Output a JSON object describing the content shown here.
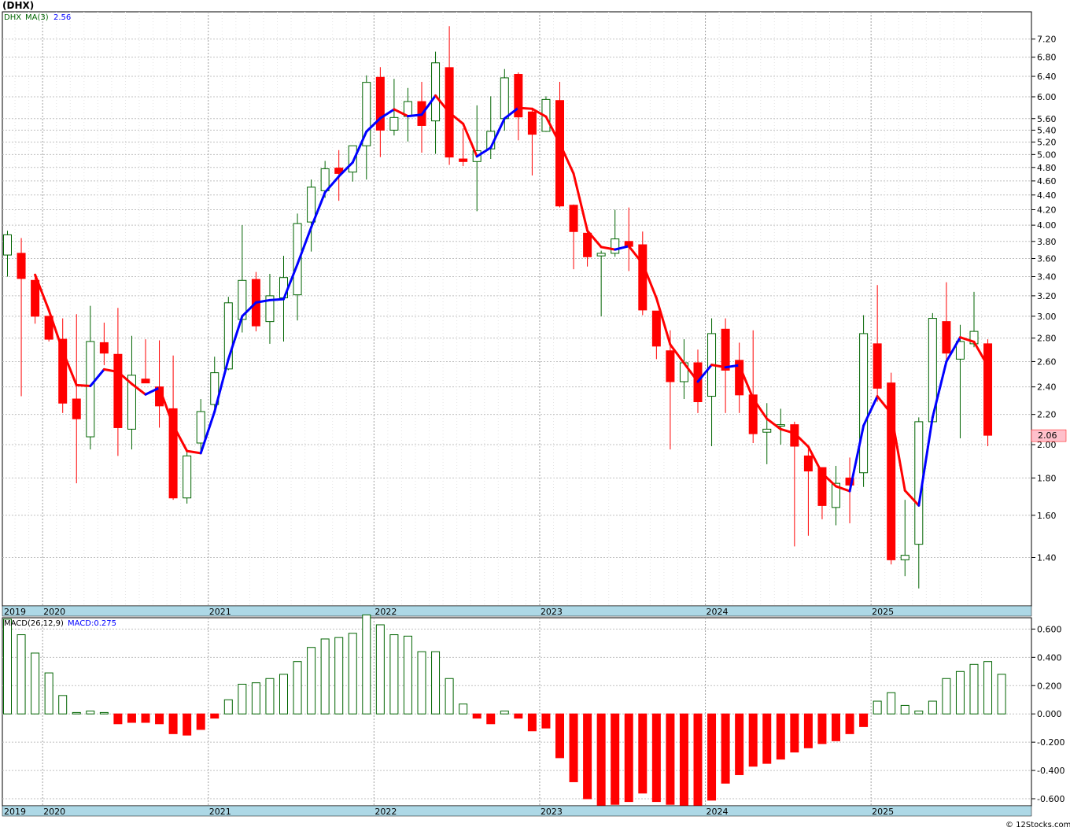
{
  "title": "(DHX)",
  "price_legend": {
    "symbol": "DHX",
    "ma_label": "MA(3)",
    "ma_value": "2.56"
  },
  "macd_legend": {
    "label": "MACD(26,12,9)",
    "value_label": "MACD:0.275"
  },
  "last_price_label": "2.06",
  "copyright": "© 12Stocks.com",
  "colors": {
    "up": "#006400",
    "down": "#ff0000",
    "ma_up": "#0000ff",
    "ma_down": "#ff0000",
    "axis_band": "#add8e6",
    "grid": "#c0c0c0",
    "price_tag_bg": "#ffc0cb"
  },
  "chart_data": [
    {
      "type": "candlestick",
      "scale": "log",
      "grid": true,
      "x_labels": [
        "2019",
        "2020",
        "2021",
        "2022",
        "2023",
        "2024",
        "2025"
      ],
      "y_ticks": [
        "1.40",
        "1.60",
        "1.80",
        "2.00",
        "2.20",
        "2.40",
        "2.60",
        "2.80",
        "3.00",
        "3.20",
        "3.40",
        "3.60",
        "3.80",
        "4.00",
        "4.20",
        "4.40",
        "4.60",
        "4.80",
        "5.00",
        "5.20",
        "5.40",
        "5.60",
        "6.00",
        "6.40",
        "6.80",
        "7.20"
      ],
      "candles": [
        {
          "o": 3.64,
          "h": 3.93,
          "l": 3.4,
          "c": 3.88
        },
        {
          "o": 3.66,
          "h": 3.84,
          "l": 2.33,
          "c": 3.38
        },
        {
          "o": 3.36,
          "h": 3.43,
          "l": 2.93,
          "c": 3.0
        },
        {
          "o": 3.0,
          "h": 3.0,
          "l": 2.77,
          "c": 2.79
        },
        {
          "o": 2.79,
          "h": 2.98,
          "l": 2.21,
          "c": 2.28
        },
        {
          "o": 2.31,
          "h": 3.02,
          "l": 1.77,
          "c": 2.17
        },
        {
          "o": 2.05,
          "h": 3.1,
          "l": 1.97,
          "c": 2.77
        },
        {
          "o": 2.76,
          "h": 2.94,
          "l": 2.57,
          "c": 2.67
        },
        {
          "o": 2.66,
          "h": 3.08,
          "l": 1.93,
          "c": 2.11
        },
        {
          "o": 2.1,
          "h": 2.82,
          "l": 1.97,
          "c": 2.49
        },
        {
          "o": 2.46,
          "h": 2.79,
          "l": 2.43,
          "c": 2.43
        },
        {
          "o": 2.4,
          "h": 2.78,
          "l": 2.11,
          "c": 2.26
        },
        {
          "o": 2.24,
          "h": 2.65,
          "l": 1.68,
          "c": 1.69
        },
        {
          "o": 1.69,
          "h": 1.97,
          "l": 1.66,
          "c": 1.93
        },
        {
          "o": 2.01,
          "h": 2.31,
          "l": 1.94,
          "c": 2.22
        },
        {
          "o": 2.27,
          "h": 2.64,
          "l": 2.2,
          "c": 2.51
        },
        {
          "o": 2.54,
          "h": 3.19,
          "l": 2.53,
          "c": 3.13
        },
        {
          "o": 2.97,
          "h": 4.0,
          "l": 2.85,
          "c": 3.36
        },
        {
          "o": 3.37,
          "h": 3.45,
          "l": 2.86,
          "c": 2.91
        },
        {
          "o": 2.95,
          "h": 3.43,
          "l": 2.75,
          "c": 3.2
        },
        {
          "o": 3.18,
          "h": 3.63,
          "l": 2.77,
          "c": 3.39
        },
        {
          "o": 3.21,
          "h": 4.15,
          "l": 2.96,
          "c": 4.02
        },
        {
          "o": 4.04,
          "h": 4.62,
          "l": 3.68,
          "c": 4.51
        },
        {
          "o": 4.46,
          "h": 4.9,
          "l": 4.36,
          "c": 4.78
        },
        {
          "o": 4.79,
          "h": 5.07,
          "l": 4.32,
          "c": 4.71
        },
        {
          "o": 4.73,
          "h": 5.06,
          "l": 4.59,
          "c": 5.14
        },
        {
          "o": 5.14,
          "h": 6.42,
          "l": 4.62,
          "c": 6.28
        },
        {
          "o": 6.38,
          "h": 6.59,
          "l": 4.96,
          "c": 5.4
        },
        {
          "o": 5.4,
          "h": 6.35,
          "l": 5.31,
          "c": 5.62
        },
        {
          "o": 5.64,
          "h": 6.17,
          "l": 5.21,
          "c": 5.91
        },
        {
          "o": 5.91,
          "h": 6.29,
          "l": 5.03,
          "c": 5.48
        },
        {
          "o": 5.56,
          "h": 6.92,
          "l": 5.01,
          "c": 6.68
        },
        {
          "o": 6.58,
          "h": 7.5,
          "l": 4.84,
          "c": 4.96
        },
        {
          "o": 4.93,
          "h": 5.43,
          "l": 4.82,
          "c": 4.89
        },
        {
          "o": 4.89,
          "h": 5.84,
          "l": 4.18,
          "c": 5.06
        },
        {
          "o": 5.09,
          "h": 6.01,
          "l": 4.93,
          "c": 5.38
        },
        {
          "o": 5.6,
          "h": 6.55,
          "l": 5.39,
          "c": 6.37
        },
        {
          "o": 6.44,
          "h": 6.48,
          "l": 5.23,
          "c": 5.63
        },
        {
          "o": 5.72,
          "h": 5.78,
          "l": 4.68,
          "c": 5.33
        },
        {
          "o": 5.38,
          "h": 6.01,
          "l": 5.37,
          "c": 5.95
        },
        {
          "o": 5.93,
          "h": 6.29,
          "l": 4.23,
          "c": 4.25
        },
        {
          "o": 4.26,
          "h": 4.27,
          "l": 3.48,
          "c": 3.92
        },
        {
          "o": 3.9,
          "h": 3.98,
          "l": 3.51,
          "c": 3.62
        },
        {
          "o": 3.63,
          "h": 3.69,
          "l": 3.0,
          "c": 3.66
        },
        {
          "o": 3.66,
          "h": 4.2,
          "l": 3.62,
          "c": 3.83
        },
        {
          "o": 3.8,
          "h": 4.23,
          "l": 3.46,
          "c": 3.74
        },
        {
          "o": 3.76,
          "h": 3.92,
          "l": 3.01,
          "c": 3.06
        },
        {
          "o": 3.05,
          "h": 3.05,
          "l": 2.62,
          "c": 2.73
        },
        {
          "o": 2.69,
          "h": 2.87,
          "l": 1.97,
          "c": 2.44
        },
        {
          "o": 2.44,
          "h": 2.79,
          "l": 2.31,
          "c": 2.59
        },
        {
          "o": 2.59,
          "h": 2.7,
          "l": 2.21,
          "c": 2.29
        },
        {
          "o": 2.33,
          "h": 2.98,
          "l": 1.99,
          "c": 2.84
        },
        {
          "o": 2.88,
          "h": 2.98,
          "l": 2.21,
          "c": 2.53
        },
        {
          "o": 2.61,
          "h": 2.76,
          "l": 2.21,
          "c": 2.34
        },
        {
          "o": 2.34,
          "h": 2.87,
          "l": 2.01,
          "c": 2.07
        },
        {
          "o": 2.08,
          "h": 2.28,
          "l": 1.88,
          "c": 2.1
        },
        {
          "o": 2.12,
          "h": 2.24,
          "l": 2.0,
          "c": 2.13
        },
        {
          "o": 2.13,
          "h": 2.15,
          "l": 1.45,
          "c": 1.99
        },
        {
          "o": 1.93,
          "h": 1.97,
          "l": 1.5,
          "c": 1.84
        },
        {
          "o": 1.86,
          "h": 1.86,
          "l": 1.58,
          "c": 1.65
        },
        {
          "o": 1.64,
          "h": 1.87,
          "l": 1.55,
          "c": 1.77
        },
        {
          "o": 1.8,
          "h": 1.92,
          "l": 1.56,
          "c": 1.76
        },
        {
          "o": 1.83,
          "h": 3.01,
          "l": 1.75,
          "c": 2.84
        },
        {
          "o": 2.75,
          "h": 3.31,
          "l": 2.29,
          "c": 2.39
        },
        {
          "o": 2.43,
          "h": 2.51,
          "l": 1.37,
          "c": 1.39
        },
        {
          "o": 1.39,
          "h": 1.68,
          "l": 1.32,
          "c": 1.41
        },
        {
          "o": 1.46,
          "h": 2.18,
          "l": 1.27,
          "c": 2.15
        },
        {
          "o": 2.15,
          "h": 3.03,
          "l": 2.15,
          "c": 2.98
        },
        {
          "o": 2.95,
          "h": 3.34,
          "l": 2.58,
          "c": 2.67
        },
        {
          "o": 2.62,
          "h": 2.92,
          "l": 2.04,
          "c": 2.77
        },
        {
          "o": 2.75,
          "h": 3.24,
          "l": 2.72,
          "c": 2.86
        },
        {
          "o": 2.75,
          "h": 2.79,
          "l": 1.99,
          "c": 2.06
        }
      ],
      "ma_period": 3
    },
    {
      "type": "bar",
      "series_label": "MACD(26,12,9)",
      "y_ticks": [
        "0.600",
        "0.400",
        "0.200",
        "0.000",
        "-0.200",
        "-0.400",
        "-0.600"
      ],
      "ylim": [
        -0.65,
        0.68
      ],
      "values": [
        0.67,
        0.56,
        0.43,
        0.29,
        0.13,
        0.01,
        0.02,
        0.01,
        -0.07,
        -0.06,
        -0.06,
        -0.07,
        -0.14,
        -0.15,
        -0.11,
        -0.03,
        0.1,
        0.21,
        0.22,
        0.25,
        0.28,
        0.37,
        0.47,
        0.53,
        0.54,
        0.57,
        0.7,
        0.63,
        0.56,
        0.55,
        0.44,
        0.44,
        0.25,
        0.07,
        -0.03,
        -0.07,
        0.02,
        -0.03,
        -0.12,
        -0.1,
        -0.31,
        -0.48,
        -0.6,
        -0.66,
        -0.64,
        -0.62,
        -0.56,
        -0.62,
        -0.64,
        -0.66,
        -0.66,
        -0.61,
        -0.49,
        -0.43,
        -0.37,
        -0.35,
        -0.32,
        -0.27,
        -0.24,
        -0.21,
        -0.19,
        -0.14,
        -0.09,
        0.09,
        0.15,
        0.06,
        0.02,
        0.09,
        0.25,
        0.3,
        0.35,
        0.37,
        0.28
      ]
    }
  ]
}
